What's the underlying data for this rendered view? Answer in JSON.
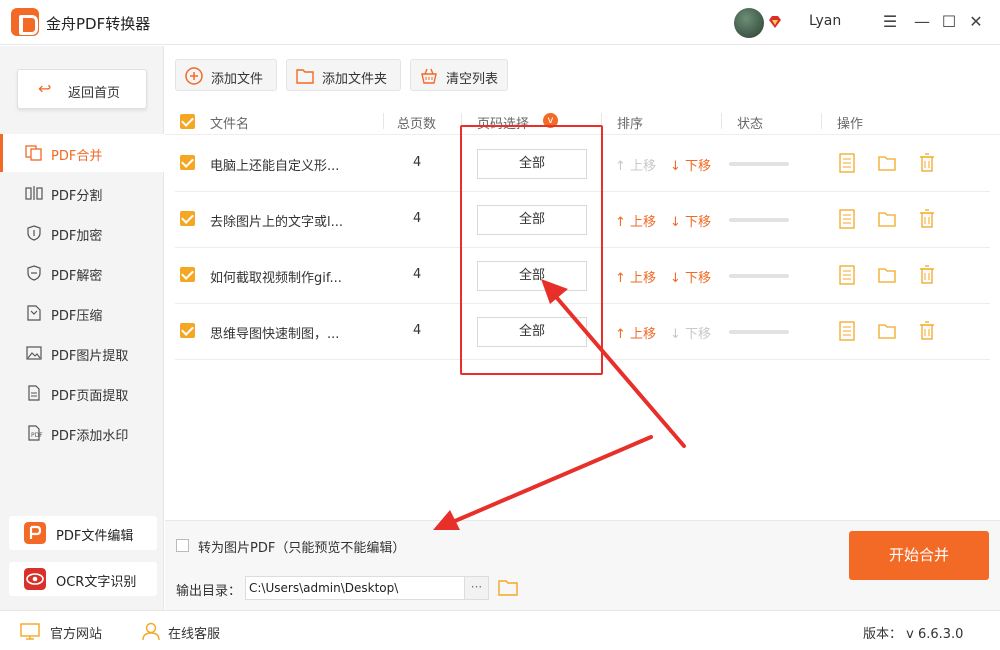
{
  "app": {
    "title": "金舟PDF转换器",
    "username": "Lyan"
  },
  "window": {
    "minimize": "☰",
    "restore": "—",
    "maximize": "☐",
    "close": "✕"
  },
  "sidebar": {
    "back_label": "返回首页",
    "items": [
      {
        "label": "PDF合并",
        "icon": "merge-icon",
        "active": true
      },
      {
        "label": "PDF分割",
        "icon": "split-icon"
      },
      {
        "label": "PDF加密",
        "icon": "shield-lock-icon"
      },
      {
        "label": "PDF解密",
        "icon": "shield-unlock-icon"
      },
      {
        "label": "PDF压缩",
        "icon": "compress-icon"
      },
      {
        "label": "PDF图片提取",
        "icon": "image-icon"
      },
      {
        "label": "PDF页面提取",
        "icon": "page-icon"
      },
      {
        "label": "PDF添加水印",
        "icon": "watermark-icon"
      }
    ],
    "tools": [
      {
        "label": "PDF文件编辑",
        "icon": "pdf-edit-icon",
        "color": "#f26a25"
      },
      {
        "label": "OCR文字识别",
        "icon": "ocr-eye-icon",
        "color": "#d9302b"
      }
    ]
  },
  "toolbar": {
    "add_file": "添加文件",
    "add_folder": "添加文件夹",
    "clear_list": "清空列表"
  },
  "table": {
    "headers": {
      "name": "文件名",
      "pages": "总页数",
      "page_select": "页码选择",
      "page_select_badge": "v",
      "order": "排序",
      "status": "状态",
      "actions": "操作"
    },
    "up_label": "上移",
    "down_label": "下移",
    "rows": [
      {
        "name": "电脑上还能自定义形...",
        "pages": "4",
        "page_select": "全部",
        "up_enabled": false,
        "down_enabled": true
      },
      {
        "name": "去除图片上的文字或l...",
        "pages": "4",
        "page_select": "全部",
        "up_enabled": true,
        "down_enabled": true
      },
      {
        "name": "如何截取视频制作gif...",
        "pages": "4",
        "page_select": "全部",
        "up_enabled": true,
        "down_enabled": true
      },
      {
        "name": "思维导图快速制图，...",
        "pages": "4",
        "page_select": "全部",
        "up_enabled": true,
        "down_enabled": false
      }
    ]
  },
  "bottom": {
    "image_pdf_label": "转为图片PDF（只能预览不能编辑）",
    "output_label": "输出目录：",
    "output_path": "C:\\Users\\admin\\Desktop\\",
    "browse_label": "···",
    "start_label": "开始合并"
  },
  "footer": {
    "website": "官方网站",
    "support": "在线客服",
    "version": "版本： v 6.6.3.0"
  },
  "colors": {
    "accent": "#f26a25",
    "annotation": "#e8302b",
    "checkbox": "#f5a623",
    "disabled": "#c8c8c8"
  }
}
